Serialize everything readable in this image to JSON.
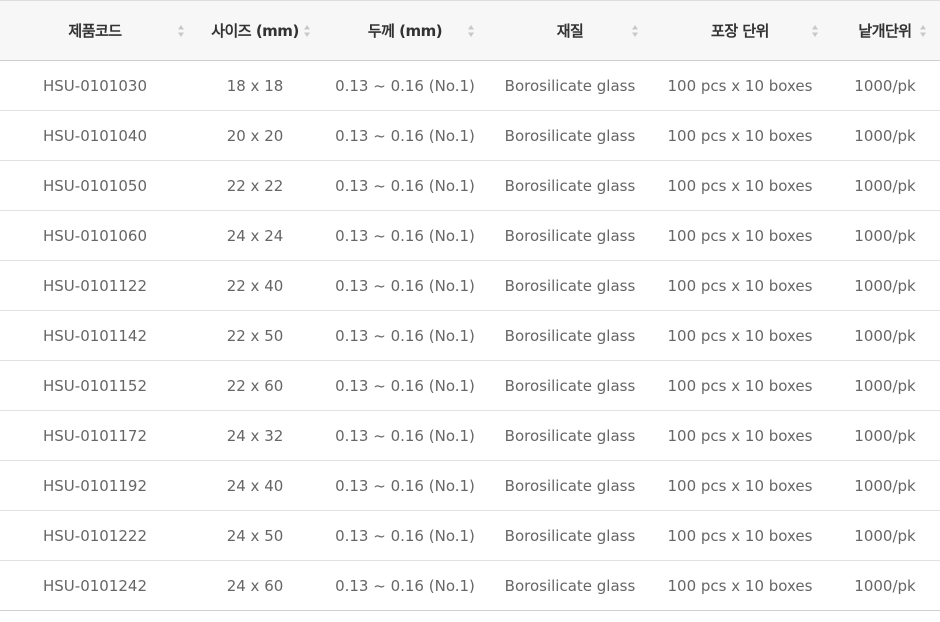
{
  "table": {
    "headers": [
      "제품코드",
      "사이즈 (mm)",
      "두께 (mm)",
      "재질",
      "포장 단위",
      "낱개단위"
    ],
    "rows": [
      [
        "HSU-0101030",
        "18 x 18",
        "0.13 ~ 0.16 (No.1)",
        "Borosilicate glass",
        "100 pcs x 10 boxes",
        "1000/pk"
      ],
      [
        "HSU-0101040",
        "20 x 20",
        "0.13 ~ 0.16 (No.1)",
        "Borosilicate glass",
        "100 pcs x 10 boxes",
        "1000/pk"
      ],
      [
        "HSU-0101050",
        "22 x 22",
        "0.13 ~ 0.16 (No.1)",
        "Borosilicate glass",
        "100 pcs x 10 boxes",
        "1000/pk"
      ],
      [
        "HSU-0101060",
        "24 x 24",
        "0.13 ~ 0.16 (No.1)",
        "Borosilicate glass",
        "100 pcs x 10 boxes",
        "1000/pk"
      ],
      [
        "HSU-0101122",
        "22 x 40",
        "0.13 ~ 0.16 (No.1)",
        "Borosilicate glass",
        "100 pcs x 10 boxes",
        "1000/pk"
      ],
      [
        "HSU-0101142",
        "22 x 50",
        "0.13 ~ 0.16 (No.1)",
        "Borosilicate glass",
        "100 pcs x 10 boxes",
        "1000/pk"
      ],
      [
        "HSU-0101152",
        "22 x 60",
        "0.13 ~ 0.16 (No.1)",
        "Borosilicate glass",
        "100 pcs x 10 boxes",
        "1000/pk"
      ],
      [
        "HSU-0101172",
        "24 x 32",
        "0.13 ~ 0.16 (No.1)",
        "Borosilicate glass",
        "100 pcs x 10 boxes",
        "1000/pk"
      ],
      [
        "HSU-0101192",
        "24 x 40",
        "0.13 ~ 0.16 (No.1)",
        "Borosilicate glass",
        "100 pcs x 10 boxes",
        "1000/pk"
      ],
      [
        "HSU-0101222",
        "24 x 50",
        "0.13 ~ 0.16 (No.1)",
        "Borosilicate glass",
        "100 pcs x 10 boxes",
        "1000/pk"
      ],
      [
        "HSU-0101242",
        "24 x 60",
        "0.13 ~ 0.16 (No.1)",
        "Borosilicate glass",
        "100 pcs x 10 boxes",
        "1000/pk"
      ]
    ],
    "sort_icon": "sort-up-down-icon",
    "colors": {
      "header_bg": "#f7f7f7",
      "header_text": "#333333",
      "cell_text": "#666666",
      "row_border": "#e2e2e2",
      "sort_arrow": "#c8c8c8"
    }
  }
}
